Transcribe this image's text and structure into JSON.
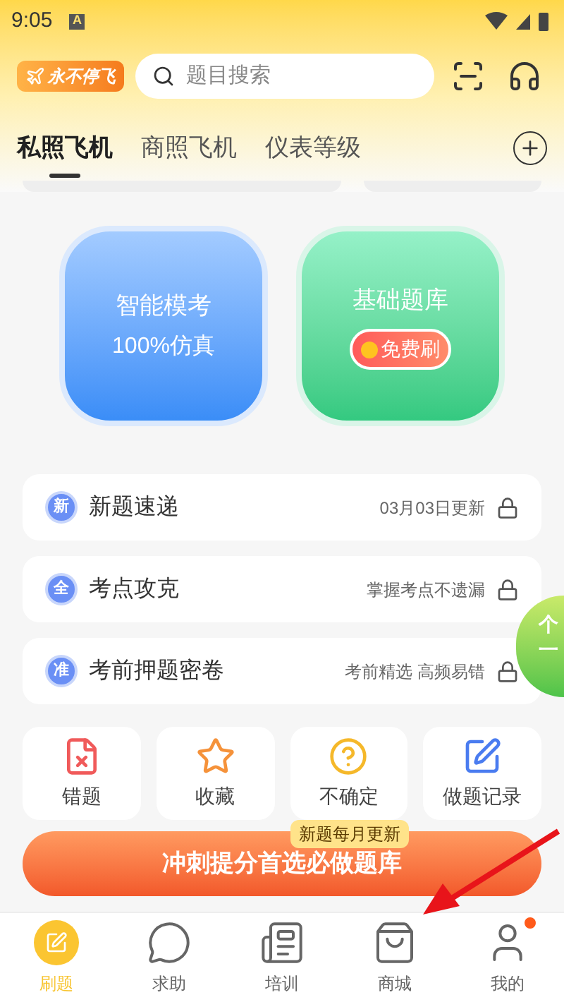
{
  "status_bar": {
    "time": "9:05",
    "notification": "A"
  },
  "header": {
    "logo_text": "永不停飞",
    "search": {
      "placeholder": "题目搜索"
    }
  },
  "tabs": [
    {
      "label": "私照飞机",
      "selected": true
    },
    {
      "label": "商照飞机",
      "selected": false
    },
    {
      "label": "仪表等级",
      "selected": false
    }
  ],
  "big_cards": [
    {
      "kind": "mock",
      "title": "智能模考",
      "subtitle": "100%仿真"
    },
    {
      "kind": "bank",
      "title": "基础题库",
      "badge": "免费刷"
    }
  ],
  "list_rows": [
    {
      "icon_char": "新",
      "title": "新题速递",
      "note": "03月03日更新",
      "locked": true
    },
    {
      "icon_char": "全",
      "title": "考点攻克",
      "note": "掌握考点不遗漏",
      "locked": true
    },
    {
      "icon_char": "准",
      "title": "考前押题密卷",
      "note": "考前精选 高频易错",
      "locked": true
    }
  ],
  "floating_widget": {
    "line_1": "个",
    "line_2": "一"
  },
  "tools": [
    {
      "kind": "wrong",
      "label": "错题"
    },
    {
      "kind": "favorite",
      "label": "收藏"
    },
    {
      "kind": "unsure",
      "label": "不确定"
    },
    {
      "kind": "record",
      "label": "做题记录"
    }
  ],
  "promo": {
    "badge": "新题每月更新",
    "button": "冲刺提分首选必做题库"
  },
  "bottom_nav": [
    {
      "kind": "practice",
      "label": "刷题",
      "selected": true,
      "dot": false
    },
    {
      "kind": "help",
      "label": "求助",
      "selected": false,
      "dot": false
    },
    {
      "kind": "training",
      "label": "培训",
      "selected": false,
      "dot": false
    },
    {
      "kind": "shop",
      "label": "商城",
      "selected": false,
      "dot": false
    },
    {
      "kind": "me",
      "label": "我的",
      "selected": false,
      "dot": true
    }
  ]
}
